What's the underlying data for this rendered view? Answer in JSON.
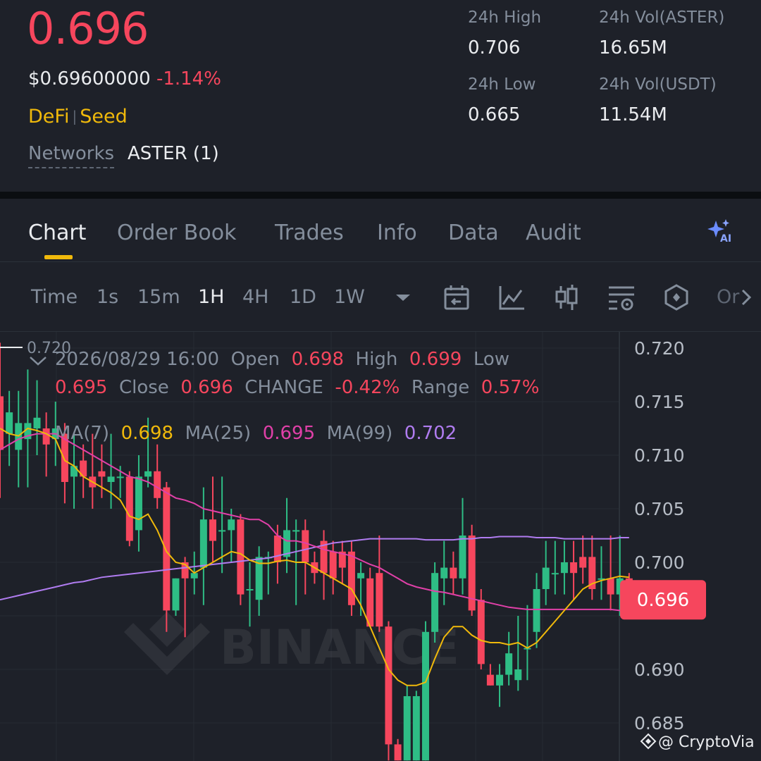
{
  "header": {
    "price": "0.696",
    "usd_price": "$0.69600000",
    "change_pct": "-1.14%",
    "tags": [
      "DeFi",
      "Seed"
    ],
    "networks_label": "Networks",
    "networks_value": "ASTER (1)",
    "stats": {
      "high_label": "24h High",
      "high_value": "0.706",
      "low_label": "24h Low",
      "low_value": "0.665",
      "vol_base_label": "24h Vol(ASTER)",
      "vol_base_value": "16.65M",
      "vol_quote_label": "24h Vol(USDT)",
      "vol_quote_value": "11.54M"
    }
  },
  "tabs": [
    "Chart",
    "Order Book",
    "Trades",
    "Info",
    "Data",
    "Audit"
  ],
  "active_tab": "Chart",
  "ai_icon": "sparkle-ai-icon",
  "intervals": [
    "Time",
    "1s",
    "15m",
    "1H",
    "4H",
    "1D",
    "1W"
  ],
  "active_interval": "1H",
  "toolbar_icons": [
    "dropdown-caret-icon",
    "calendar-replay-icon",
    "line-chart-icon",
    "candlestick-icon",
    "chart-settings-icon",
    "hexagon-icon",
    "more-tools-icon"
  ],
  "toolbar_more_text": "Or",
  "ohlc": {
    "datetime": "2026/08/29 16:00",
    "open_label": "Open",
    "open": "0.698",
    "high_label": "High",
    "high": "0.699",
    "low_label": "Low",
    "low": "0.695",
    "close_label": "Close",
    "close": "0.696",
    "change_label": "CHANGE",
    "change": "-0.42%",
    "range_label": "Range",
    "range": "0.57%"
  },
  "ma": {
    "ma7_label": "MA(7)",
    "ma7": "0.698",
    "ma25_label": "MA(25)",
    "ma25": "0.695",
    "ma99_label": "MA(99)",
    "ma99": "0.702"
  },
  "chart_top_marker": "0.720",
  "watermark": "BINANCE",
  "credit": "@ CryptoVia",
  "colors": {
    "up": "#2ebd85",
    "down": "#f6465d",
    "gold": "#f0b90b",
    "ma7": "#f0b90b",
    "ma25": "#e040a8",
    "ma99": "#b07cf0",
    "bg": "#1e2129"
  },
  "chart_data": {
    "type": "candlestick",
    "y_ticks": [
      "0.720",
      "0.715",
      "0.710",
      "0.705",
      "0.700",
      "0.690",
      "0.685"
    ],
    "ylim": [
      0.6815,
      0.7215
    ],
    "current_price_label": "0.696",
    "current_price": 0.6965,
    "candles": [
      {
        "o": 0.7155,
        "c": 0.7105,
        "h": 0.7205,
        "l": 0.706
      },
      {
        "o": 0.712,
        "c": 0.714,
        "h": 0.716,
        "l": 0.709
      },
      {
        "o": 0.7105,
        "c": 0.713,
        "h": 0.716,
        "l": 0.707
      },
      {
        "o": 0.7115,
        "c": 0.713,
        "h": 0.718,
        "l": 0.707
      },
      {
        "o": 0.7125,
        "c": 0.7135,
        "h": 0.717,
        "l": 0.71
      },
      {
        "o": 0.7125,
        "c": 0.711,
        "h": 0.714,
        "l": 0.708
      },
      {
        "o": 0.7115,
        "c": 0.7125,
        "h": 0.715,
        "l": 0.709
      },
      {
        "o": 0.712,
        "c": 0.7075,
        "h": 0.713,
        "l": 0.7055
      },
      {
        "o": 0.708,
        "c": 0.709,
        "h": 0.712,
        "l": 0.705
      },
      {
        "o": 0.7095,
        "c": 0.708,
        "h": 0.711,
        "l": 0.706
      },
      {
        "o": 0.708,
        "c": 0.707,
        "h": 0.712,
        "l": 0.705
      },
      {
        "o": 0.7085,
        "c": 0.708,
        "h": 0.711,
        "l": 0.706
      },
      {
        "o": 0.7075,
        "c": 0.708,
        "h": 0.712,
        "l": 0.705
      },
      {
        "o": 0.708,
        "c": 0.708,
        "h": 0.709,
        "l": 0.706
      },
      {
        "o": 0.708,
        "c": 0.702,
        "h": 0.7085,
        "l": 0.7015
      },
      {
        "o": 0.703,
        "c": 0.708,
        "h": 0.71,
        "l": 0.701
      },
      {
        "o": 0.708,
        "c": 0.7085,
        "h": 0.7135,
        "l": 0.707
      },
      {
        "o": 0.7085,
        "c": 0.706,
        "h": 0.711,
        "l": 0.705
      },
      {
        "o": 0.707,
        "c": 0.6955,
        "h": 0.7075,
        "l": 0.6935
      },
      {
        "o": 0.6955,
        "c": 0.6985,
        "h": 0.6985,
        "l": 0.695
      },
      {
        "o": 0.7,
        "c": 0.6985,
        "h": 0.7005,
        "l": 0.693
      },
      {
        "o": 0.6985,
        "c": 0.699,
        "h": 0.701,
        "l": 0.697
      },
      {
        "o": 0.6995,
        "c": 0.704,
        "h": 0.707,
        "l": 0.696
      },
      {
        "o": 0.704,
        "c": 0.702,
        "h": 0.708,
        "l": 0.7
      },
      {
        "o": 0.703,
        "c": 0.703,
        "h": 0.708,
        "l": 0.699
      },
      {
        "o": 0.703,
        "c": 0.704,
        "h": 0.705,
        "l": 0.7
      },
      {
        "o": 0.704,
        "c": 0.697,
        "h": 0.7045,
        "l": 0.696
      },
      {
        "o": 0.6975,
        "c": 0.6975,
        "h": 0.7,
        "l": 0.694
      },
      {
        "o": 0.6965,
        "c": 0.7005,
        "h": 0.7015,
        "l": 0.695
      },
      {
        "o": 0.7005,
        "c": 0.7005,
        "h": 0.701,
        "l": 0.697
      },
      {
        "o": 0.7025,
        "c": 0.7,
        "h": 0.7035,
        "l": 0.698
      },
      {
        "o": 0.7005,
        "c": 0.703,
        "h": 0.706,
        "l": 0.699
      },
      {
        "o": 0.703,
        "c": 0.703,
        "h": 0.704,
        "l": 0.696
      },
      {
        "o": 0.703,
        "c": 0.7,
        "h": 0.704,
        "l": 0.697
      },
      {
        "o": 0.7,
        "c": 0.699,
        "h": 0.701,
        "l": 0.698
      },
      {
        "o": 0.702,
        "c": 0.699,
        "h": 0.703,
        "l": 0.6965
      },
      {
        "o": 0.701,
        "c": 0.6985,
        "h": 0.702,
        "l": 0.697
      },
      {
        "o": 0.701,
        "c": 0.6995,
        "h": 0.702,
        "l": 0.698
      },
      {
        "o": 0.701,
        "c": 0.696,
        "h": 0.702,
        "l": 0.695
      },
      {
        "o": 0.6985,
        "c": 0.699,
        "h": 0.7,
        "l": 0.695
      },
      {
        "o": 0.6985,
        "c": 0.694,
        "h": 0.6995,
        "l": 0.694
      },
      {
        "o": 0.699,
        "c": 0.694,
        "h": 0.7025,
        "l": 0.6935
      },
      {
        "o": 0.694,
        "c": 0.683,
        "h": 0.6945,
        "l": 0.6815
      },
      {
        "o": 0.683,
        "c": 0.6815,
        "h": 0.6835,
        "l": 0.6815
      },
      {
        "o": 0.6815,
        "c": 0.6875,
        "h": 0.6885,
        "l": 0.6815
      },
      {
        "o": 0.6815,
        "c": 0.6875,
        "h": 0.688,
        "l": 0.6815
      },
      {
        "o": 0.6815,
        "c": 0.6935,
        "h": 0.6945,
        "l": 0.6815
      },
      {
        "o": 0.6935,
        "c": 0.699,
        "h": 0.7,
        "l": 0.6925
      },
      {
        "o": 0.6985,
        "c": 0.6995,
        "h": 0.702,
        "l": 0.696
      },
      {
        "o": 0.6995,
        "c": 0.6985,
        "h": 0.701,
        "l": 0.697
      },
      {
        "o": 0.6985,
        "c": 0.7025,
        "h": 0.706,
        "l": 0.697
      },
      {
        "o": 0.7025,
        "c": 0.6955,
        "h": 0.7035,
        "l": 0.695
      },
      {
        "o": 0.6965,
        "c": 0.6905,
        "h": 0.6975,
        "l": 0.69
      },
      {
        "o": 0.6895,
        "c": 0.6885,
        "h": 0.6905,
        "l": 0.6885
      },
      {
        "o": 0.6885,
        "c": 0.6895,
        "h": 0.6905,
        "l": 0.6865
      },
      {
        "o": 0.6895,
        "c": 0.6915,
        "h": 0.6935,
        "l": 0.6885
      },
      {
        "o": 0.689,
        "c": 0.69,
        "h": 0.695,
        "l": 0.688
      },
      {
        "o": 0.692,
        "c": 0.692,
        "h": 0.696,
        "l": 0.689
      },
      {
        "o": 0.6935,
        "c": 0.6975,
        "h": 0.699,
        "l": 0.692
      },
      {
        "o": 0.6975,
        "c": 0.6995,
        "h": 0.702,
        "l": 0.696
      },
      {
        "o": 0.699,
        "c": 0.699,
        "h": 0.702,
        "l": 0.697
      },
      {
        "o": 0.699,
        "c": 0.7,
        "h": 0.702,
        "l": 0.697
      },
      {
        "o": 0.7,
        "c": 0.699,
        "h": 0.702,
        "l": 0.6965
      },
      {
        "o": 0.7005,
        "c": 0.6995,
        "h": 0.7025,
        "l": 0.698
      },
      {
        "o": 0.7005,
        "c": 0.6975,
        "h": 0.7025,
        "l": 0.6965
      },
      {
        "o": 0.6985,
        "c": 0.6985,
        "h": 0.7015,
        "l": 0.6965
      },
      {
        "o": 0.6985,
        "c": 0.697,
        "h": 0.7025,
        "l": 0.6955
      },
      {
        "o": 0.697,
        "c": 0.6985,
        "h": 0.7025,
        "l": 0.695
      },
      {
        "o": 0.6985,
        "c": 0.6965,
        "h": 0.699,
        "l": 0.6955
      }
    ],
    "ma7": [
      0.7125,
      0.712,
      0.7118,
      0.7125,
      0.7123,
      0.712,
      0.7115,
      0.7095,
      0.709,
      0.708,
      0.7075,
      0.707,
      0.7065,
      0.7058,
      0.7043,
      0.704,
      0.7045,
      0.703,
      0.701,
      0.7,
      0.6998,
      0.699,
      0.6995,
      0.7,
      0.7005,
      0.701,
      0.7008,
      0.7002,
      0.6999,
      0.6999,
      0.7001,
      0.7002,
      0.7,
      0.7,
      0.6995,
      0.699,
      0.6985,
      0.698,
      0.6975,
      0.696,
      0.694,
      0.692,
      0.69,
      0.689,
      0.6885,
      0.6885,
      0.6888,
      0.691,
      0.693,
      0.694,
      0.694,
      0.6932,
      0.6927,
      0.6925,
      0.6925,
      0.6923,
      0.6925,
      0.692,
      0.6925,
      0.6935,
      0.6945,
      0.6955,
      0.6965,
      0.6975,
      0.698,
      0.6983,
      0.6985,
      0.6987,
      0.6986
    ],
    "ma25": [
      0.7105,
      0.711,
      0.7115,
      0.7118,
      0.712,
      0.712,
      0.712,
      0.7115,
      0.711,
      0.7105,
      0.71,
      0.7095,
      0.709,
      0.7085,
      0.708,
      0.7078,
      0.7075,
      0.707,
      0.7065,
      0.706,
      0.7058,
      0.7055,
      0.705,
      0.7048,
      0.7046,
      0.7044,
      0.7042,
      0.704,
      0.704,
      0.7035,
      0.7025,
      0.702,
      0.702,
      0.7018,
      0.7015,
      0.7012,
      0.701,
      0.7008,
      0.7006,
      0.7002,
      0.6998,
      0.6995,
      0.699,
      0.6985,
      0.698,
      0.6977,
      0.6975,
      0.6973,
      0.6972,
      0.697,
      0.6968,
      0.6966,
      0.6964,
      0.6962,
      0.696,
      0.6958,
      0.6957,
      0.6956,
      0.6956,
      0.6956,
      0.6956,
      0.6956,
      0.6956,
      0.6956,
      0.6956,
      0.6956,
      0.6956,
      0.6955,
      0.6955
    ],
    "ma99": [
      0.6965,
      0.6967,
      0.6969,
      0.6971,
      0.6973,
      0.6975,
      0.6977,
      0.6979,
      0.6981,
      0.6982,
      0.6984,
      0.6986,
      0.6987,
      0.6988,
      0.6989,
      0.699,
      0.6991,
      0.6992,
      0.6993,
      0.6994,
      0.6995,
      0.6996,
      0.6997,
      0.6998,
      0.6999,
      0.7,
      0.7001,
      0.7002,
      0.7003,
      0.7004,
      0.7006,
      0.7008,
      0.701,
      0.7012,
      0.7014,
      0.7016,
      0.7018,
      0.7019,
      0.702,
      0.7021,
      0.7022,
      0.7022,
      0.7022,
      0.7022,
      0.7022,
      0.7022,
      0.7021,
      0.7021,
      0.7021,
      0.7021,
      0.7022,
      0.7022,
      0.7023,
      0.7023,
      0.7024,
      0.7024,
      0.7024,
      0.7024,
      0.7023,
      0.7023,
      0.7023,
      0.7022,
      0.7022,
      0.7022,
      0.7022,
      0.7022,
      0.7022,
      0.7023,
      0.7023
    ]
  }
}
